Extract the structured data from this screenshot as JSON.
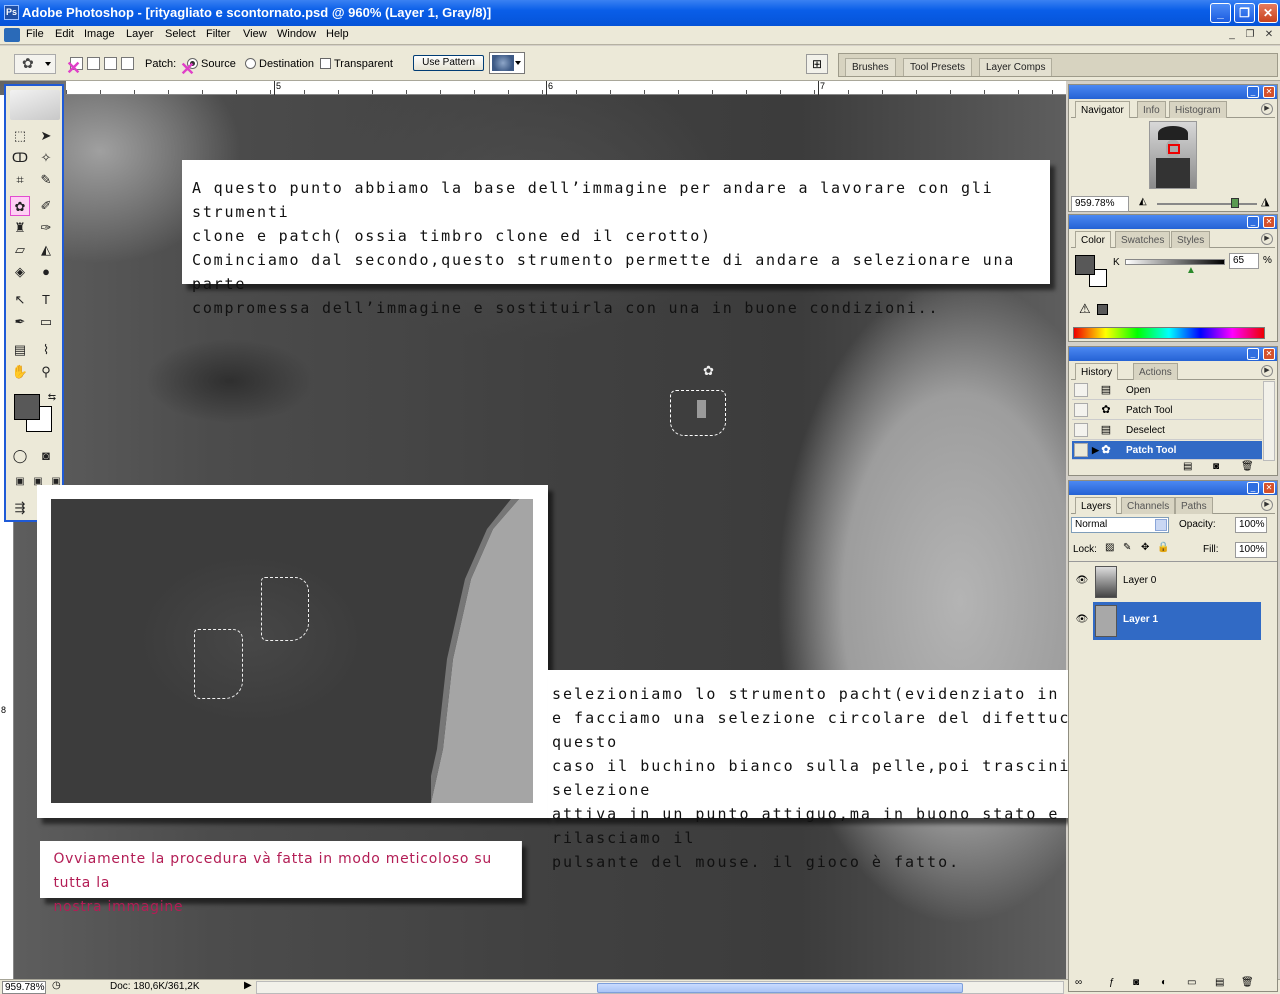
{
  "window": {
    "title": "Adobe Photoshop - [rityagliato e scontornato.psd @ 960% (Layer 1, Gray/8)]",
    "buttons": [
      "_",
      "❐",
      "✕"
    ]
  },
  "menu": {
    "items": [
      "File",
      "Edit",
      "Image",
      "Layer",
      "Select",
      "Filter",
      "View",
      "Window",
      "Help"
    ],
    "doc_buttons": [
      "_",
      "❐",
      "✕"
    ]
  },
  "options": {
    "patch_label": "Patch:",
    "source_label": "Source",
    "destination_label": "Destination",
    "transparent_label": "Transparent",
    "use_pattern_label": "Use Pattern",
    "patch_mode": "Source",
    "transparent_checked": false
  },
  "dock": {
    "tabs": [
      "Brushes",
      "Tool Presets",
      "Layer Comps"
    ]
  },
  "rulers": {
    "h_numbers": [
      "5",
      "6",
      "7"
    ],
    "v_numbers": [
      "8"
    ]
  },
  "notes": {
    "top": "A questo punto abbiamo la base dell’immagine per andare a lavorare con gli strumenti\nclone e patch( ossia timbro clone ed il cerotto)\nCominciamo dal secondo,questo strumento permette di andare a selezionare una parte\ncompromessa dell’immagine e sostituirla con una in buone condizioni..",
    "bottom": "selezioniamo lo strumento pacht(evidenziato in rosa)\ne facciamo una selezione circolare del difettuccio,in questo\ncaso il buchino bianco sulla pelle,poi trasciniamo la selezione\nattiva in un punto attiguo,ma in buono stato e rilasciamo il\npulsante del mouse. il gioco è fatto.",
    "red": "Ovviamente la procedura và fatta in modo meticoloso su tutta la\nnostra immagine"
  },
  "navigator": {
    "tabs": [
      "Navigator",
      "Info",
      "Histogram"
    ],
    "zoom": "959.78%",
    "zoom_slider": 0.8
  },
  "color": {
    "tabs": [
      "Color",
      "Swatches",
      "Styles"
    ],
    "channel_label": "K",
    "value": "65",
    "unit": "%"
  },
  "history": {
    "tabs": [
      "History",
      "Actions"
    ],
    "items": [
      {
        "label": "Open",
        "icon": "▤"
      },
      {
        "label": "Patch Tool",
        "icon": "✿"
      },
      {
        "label": "Deselect",
        "icon": "▤"
      },
      {
        "label": "Patch Tool",
        "icon": "✿"
      }
    ],
    "selected_index": 3
  },
  "layers": {
    "tabs": [
      "Layers",
      "Channels",
      "Paths"
    ],
    "blend_mode": "Normal",
    "opacity_label": "Opacity:",
    "opacity": "100%",
    "lock_label": "Lock:",
    "fill_label": "Fill:",
    "fill": "100%",
    "items": [
      {
        "name": "Layer 0",
        "selected": false
      },
      {
        "name": "Layer 1",
        "selected": true
      }
    ]
  },
  "status": {
    "zoom": "959.78%",
    "doc": "Doc: 180,6K/361,2K"
  },
  "colors": {
    "title_bar": "#0a5ee8",
    "selection": "#316ac5",
    "note_red": "#b31d55",
    "patch_highlight": "#e24bd0",
    "foreground": "#585858",
    "background": "#ffffff"
  }
}
